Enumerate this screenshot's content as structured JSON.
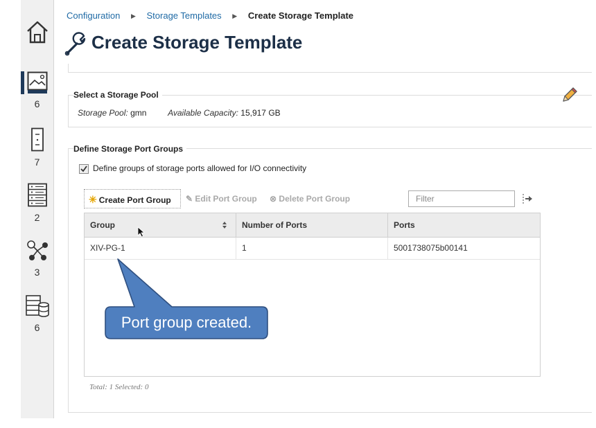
{
  "breadcrumb": {
    "items": [
      "Configuration",
      "Storage Templates"
    ],
    "current": "Create Storage Template"
  },
  "page": {
    "title": "Create Storage Template",
    "icon": "wrench-icon"
  },
  "rail": [
    {
      "icon": "home-icon",
      "count": ""
    },
    {
      "icon": "storage-system-icon",
      "count": "6"
    },
    {
      "icon": "server-icon",
      "count": "7"
    },
    {
      "icon": "switch-icon",
      "count": "2"
    },
    {
      "icon": "fabric-icon",
      "count": "3"
    },
    {
      "icon": "storage-database-icon",
      "count": "6"
    }
  ],
  "storage_pool": {
    "heading": "Select a Storage Pool",
    "pool_label": "Storage Pool:",
    "pool_value": "gmn",
    "capacity_label": "Available Capacity:",
    "capacity_value": "15,917 GB"
  },
  "port_groups": {
    "heading": "Define Storage Port Groups",
    "checkbox_label": "Define groups of storage ports allowed for I/O connectivity",
    "checkbox_checked": true,
    "toolbar": {
      "create": "Create Port Group",
      "edit": "Edit Port Group",
      "delete": "Delete Port Group",
      "filter_placeholder": "Filter"
    },
    "columns": [
      "Group",
      "Number of Ports",
      "Ports"
    ],
    "rows": [
      {
        "group": "XIV-PG-1",
        "num_ports": "1",
        "ports": "5001738075b00141"
      }
    ],
    "footer": "Total: 1 Selected: 0"
  },
  "callout": {
    "text": "Port group created."
  },
  "colors": {
    "title": "#1c2f47",
    "link": "#1f6aa5",
    "callout_fill": "#4f7fbf",
    "callout_border": "#2f4f7f",
    "disabled": "#a9a9a9"
  }
}
